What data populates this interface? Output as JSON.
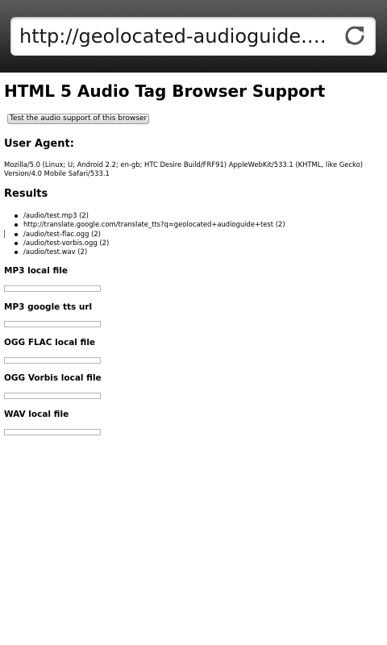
{
  "browser": {
    "url": "http://geolocated-audioguide.herokuapp.com/"
  },
  "page": {
    "title": "HTML 5 Audio Tag Browser Support",
    "test_button_label": "Test the audio support of this browser",
    "user_agent_heading": "User Agent:",
    "user_agent": "Mozilla/5.0 (Linux; U; Android 2.2; en-gb; HTC Desire Build/FRF91) AppleWebKit/533.1 (KHTML, like Gecko) Version/4.0 Mobile Safari/533.1",
    "results_heading": "Results",
    "results": [
      {
        "path": "/audio/test.mp3",
        "count": "(2)"
      },
      {
        "path": "http://translate.google.com/translate_tts?q=geolocated+audioguide+test",
        "count": "(2)"
      },
      {
        "path": "/audio/test-flac.ogg",
        "count": "(2)"
      },
      {
        "path": "/audio/test-vorbis.ogg",
        "count": "(2)"
      },
      {
        "path": "/audio/test.wav",
        "count": "(2)"
      }
    ],
    "audio_sections": [
      {
        "label": "MP3 local file"
      },
      {
        "label": "MP3 google tts url"
      },
      {
        "label": "OGG FLAC local file"
      },
      {
        "label": "OGG Vorbis local file"
      },
      {
        "label": "WAV local file"
      }
    ]
  }
}
